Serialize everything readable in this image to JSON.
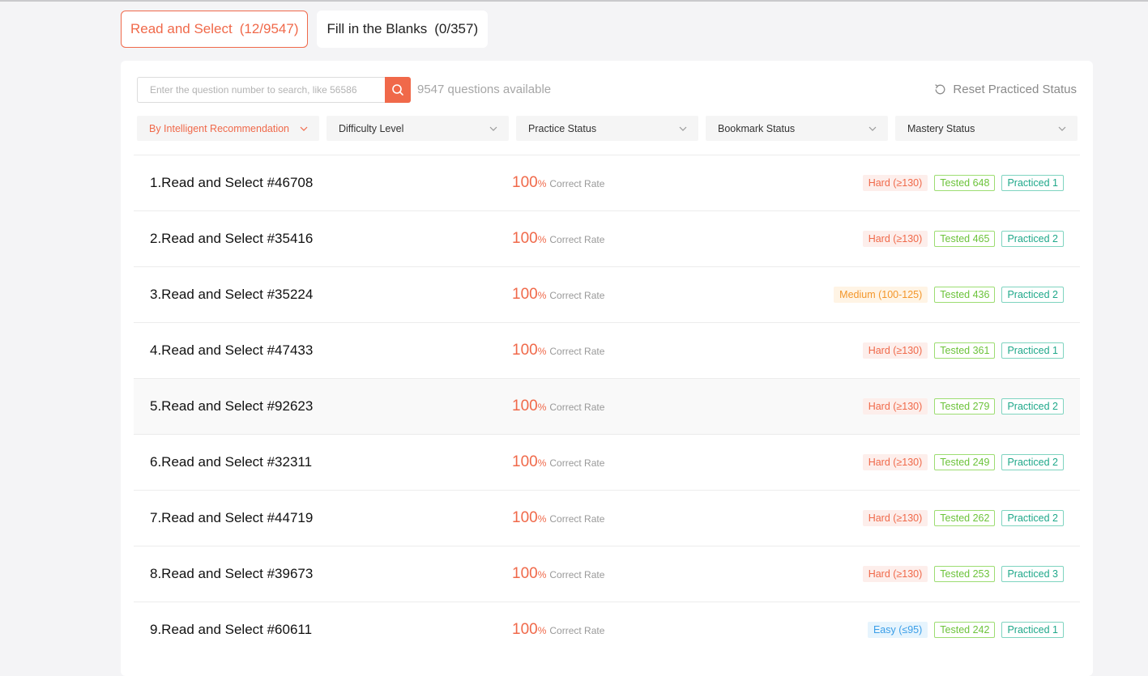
{
  "tabs": [
    {
      "label": "Read and Select",
      "count": "(12/9547)"
    },
    {
      "label": "Fill in the Blanks",
      "count": "(0/357)"
    }
  ],
  "search": {
    "placeholder": "Enter the question number to search, like 56586"
  },
  "available_text": "9547 questions available",
  "reset_label": "Reset Practiced Status",
  "filters": [
    "By Intelligent Recommendation",
    "Difficulty Level",
    "Practice Status",
    "Bookmark Status",
    "Mastery Status"
  ],
  "rate_label": "Correct Rate",
  "colors": {
    "accent": "#f0694a",
    "tested": "#6cc33a",
    "practiced": "#1fa88a",
    "medium": "#f3962a",
    "easy": "#3a9ee8"
  },
  "questions": [
    {
      "title": "1.Read and Select #46708",
      "rate": "100",
      "pct": "%",
      "difficulty": "Hard (≥130)",
      "tested": "Tested 648",
      "practiced": "Practiced 1"
    },
    {
      "title": "2.Read and Select #35416",
      "rate": "100",
      "pct": "%",
      "difficulty": "Hard (≥130)",
      "tested": "Tested 465",
      "practiced": "Practiced 2"
    },
    {
      "title": "3.Read and Select #35224",
      "rate": "100",
      "pct": "%",
      "difficulty": "Medium (100-125)",
      "tested": "Tested 436",
      "practiced": "Practiced 2"
    },
    {
      "title": "4.Read and Select #47433",
      "rate": "100",
      "pct": "%",
      "difficulty": "Hard (≥130)",
      "tested": "Tested 361",
      "practiced": "Practiced 1"
    },
    {
      "title": "5.Read and Select #92623",
      "rate": "100",
      "pct": "%",
      "difficulty": "Hard (≥130)",
      "tested": "Tested 279",
      "practiced": "Practiced 2"
    },
    {
      "title": "6.Read and Select #32311",
      "rate": "100",
      "pct": "%",
      "difficulty": "Hard (≥130)",
      "tested": "Tested 249",
      "practiced": "Practiced 2"
    },
    {
      "title": "7.Read and Select #44719",
      "rate": "100",
      "pct": "%",
      "difficulty": "Hard (≥130)",
      "tested": "Tested 262",
      "practiced": "Practiced 2"
    },
    {
      "title": "8.Read and Select #39673",
      "rate": "100",
      "pct": "%",
      "difficulty": "Hard (≥130)",
      "tested": "Tested 253",
      "practiced": "Practiced 3"
    },
    {
      "title": "9.Read and Select #60611",
      "rate": "100",
      "pct": "%",
      "difficulty": "Easy (≤95)",
      "tested": "Tested 242",
      "practiced": "Practiced 1"
    }
  ]
}
